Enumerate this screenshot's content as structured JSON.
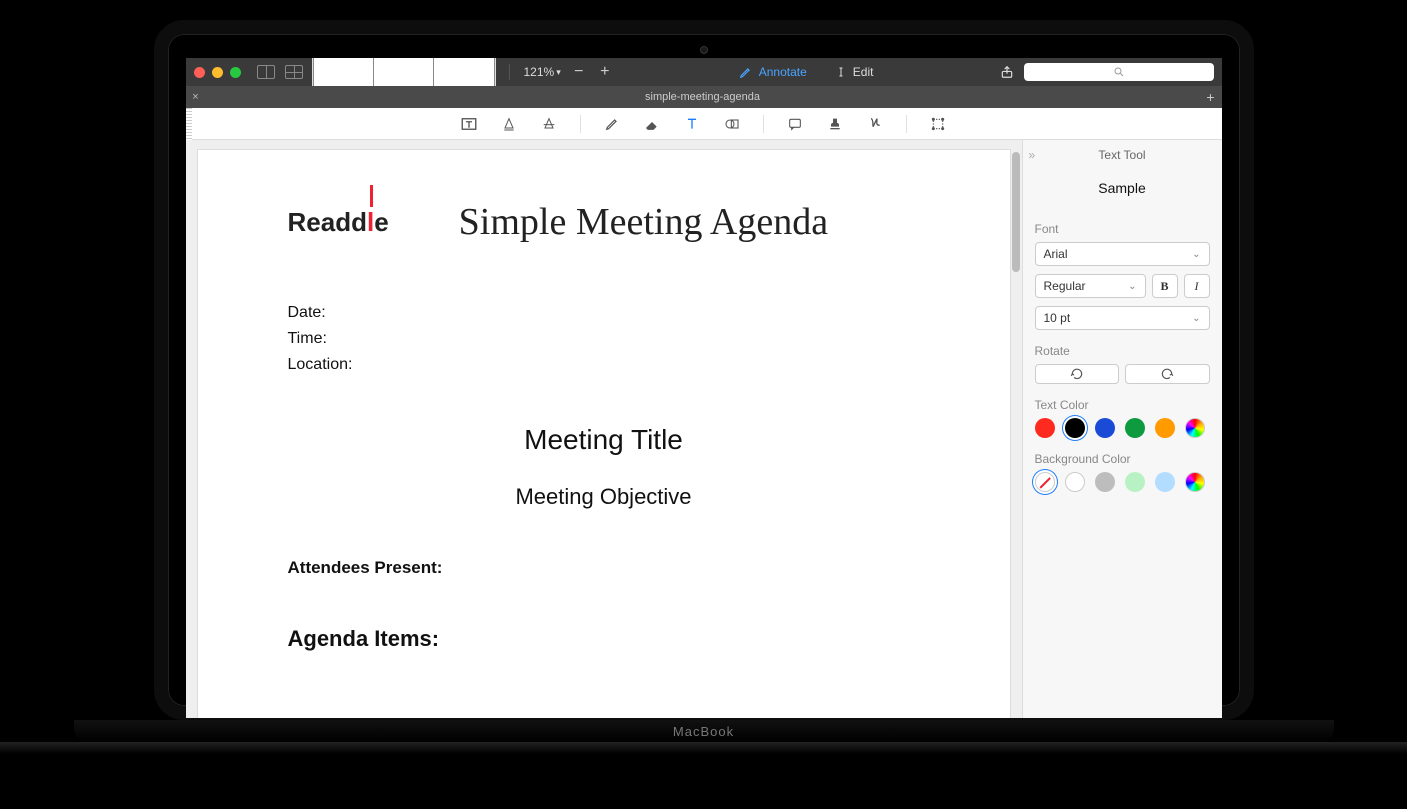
{
  "topbar": {
    "zoom": "121%",
    "mode_annotate": "Annotate",
    "mode_edit": "Edit",
    "search_placeholder": ""
  },
  "tab": {
    "title": "simple-meeting-agenda"
  },
  "document": {
    "brand": "Readdle",
    "title": "Simple Meeting Agenda",
    "fields": {
      "date": "Date:",
      "time": "Time:",
      "location": "Location:"
    },
    "meeting_title": "Meeting Title",
    "meeting_objective": "Meeting Objective",
    "attendees_label": "Attendees Present:",
    "agenda_label": "Agenda Items:"
  },
  "inspector": {
    "title": "Text Tool",
    "sample": "Sample",
    "font_label": "Font",
    "font_family": "Arial",
    "font_style": "Regular",
    "bold": "B",
    "italic": "I",
    "font_size": "10 pt",
    "rotate_label": "Rotate",
    "text_color_label": "Text Color",
    "bg_color_label": "Background Color",
    "text_colors": [
      "#ff2a1f",
      "#000000",
      "#1a4bd6",
      "#0e9a3f",
      "#ff9a00"
    ],
    "bg_colors": [
      "none",
      "#ffffff",
      "#bdbdbd",
      "#b8f2c4",
      "#b3ddff"
    ],
    "selected_text_color_index": 1,
    "selected_bg_color_index": 0
  },
  "laptop_label": "MacBook"
}
